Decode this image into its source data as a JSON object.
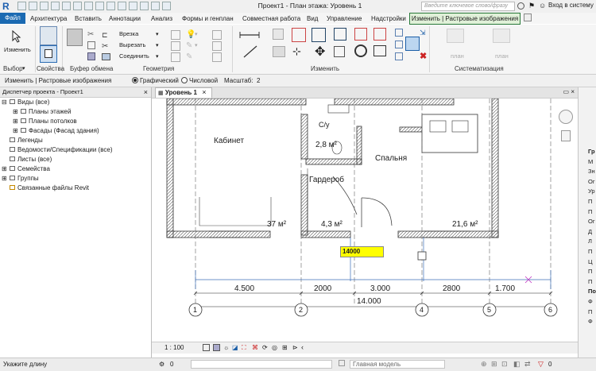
{
  "titlebar": {
    "title": "Проект1 - План этажа: Уровень 1",
    "search_placeholder": "Введите ключевое слово/фразу",
    "login": "Вход в систему",
    "logo": "R"
  },
  "menu": {
    "file": "Файл",
    "tabs": [
      "Архитектура",
      "Вставить",
      "Аннотации",
      "Анализ",
      "Формы и генплан",
      "Совместная работа",
      "Вид",
      "Управление",
      "Надстройки"
    ],
    "context_tab": "Изменить | Растровые изображения"
  },
  "ribbon": {
    "modify_label": "Изменить",
    "group_select": "Выбор",
    "group_properties": "Свойства",
    "group_clipboard": "Буфер обмена",
    "group_geometry": "Геометрия",
    "group_modify": "Изменить",
    "group_arrange": "Систематизация",
    "geometry_items": [
      "Врезка",
      "Вырезать",
      "Соединить"
    ],
    "arrange_items": [
      "план",
      "план"
    ]
  },
  "optionsbar": {
    "context": "Изменить | Растровые изображения",
    "radio_graphic": "Графический",
    "radio_numeric": "Числовой",
    "scale_label": "Масштаб:",
    "scale_value": "2"
  },
  "browser": {
    "header": "Диспетчер проекта - Проект1",
    "items": [
      {
        "label": "Виды (все)",
        "level": 0,
        "toggle": "⊟"
      },
      {
        "label": "Планы этажей",
        "level": 1,
        "toggle": "⊞"
      },
      {
        "label": "Планы потолков",
        "level": 1,
        "toggle": "⊞"
      },
      {
        "label": "Фасады (Фасад здания)",
        "level": 1,
        "toggle": "⊞"
      },
      {
        "label": "Легенды",
        "level": 0,
        "toggle": ""
      },
      {
        "label": "Ведомости/Спецификации (все)",
        "level": 0,
        "toggle": ""
      },
      {
        "label": "Листы (все)",
        "level": 0,
        "toggle": ""
      },
      {
        "label": "Семейства",
        "level": 0,
        "toggle": "⊞"
      },
      {
        "label": "Группы",
        "level": 0,
        "toggle": "⊞"
      },
      {
        "label": "Связанные файлы Revit",
        "level": 0,
        "toggle": ""
      }
    ]
  },
  "view": {
    "tab_label": "Уровень 1",
    "rooms": [
      {
        "name": "Кабинет",
        "area": "37 м²"
      },
      {
        "name": "С/у",
        "area": "2,8 м²"
      },
      {
        "name": "Гардероб",
        "area": "4,3 м²"
      },
      {
        "name": "Спальня",
        "area": "21,6 м²"
      }
    ],
    "input_value": "14000",
    "dims": [
      "4.500",
      "2000",
      "3.000",
      "2800",
      "1.700"
    ],
    "total_dim": "14.000",
    "grid": [
      "1",
      "2",
      "3",
      "4",
      "5",
      "6"
    ]
  },
  "viewcontrol": {
    "scale": "1 : 100"
  },
  "status": {
    "hint": "Укажите длину",
    "selection_count": "0",
    "model": "Главная модель"
  },
  "properties_panel": {
    "letters": [
      "Гр",
      "М",
      "Зн",
      "Ог",
      "Ур",
      "П",
      "П",
      "Ог",
      "Д",
      "Л",
      "П",
      "Ц",
      "П",
      "П",
      "По",
      "Ф",
      "П",
      "Ф"
    ]
  },
  "colors": {
    "file_tab": "#1b6ab2",
    "context_tab_bg": "#e0f0d8",
    "context_border": "#2a7a3a",
    "input_box": "#ffff00",
    "dim_line": "#3c6fb8"
  }
}
